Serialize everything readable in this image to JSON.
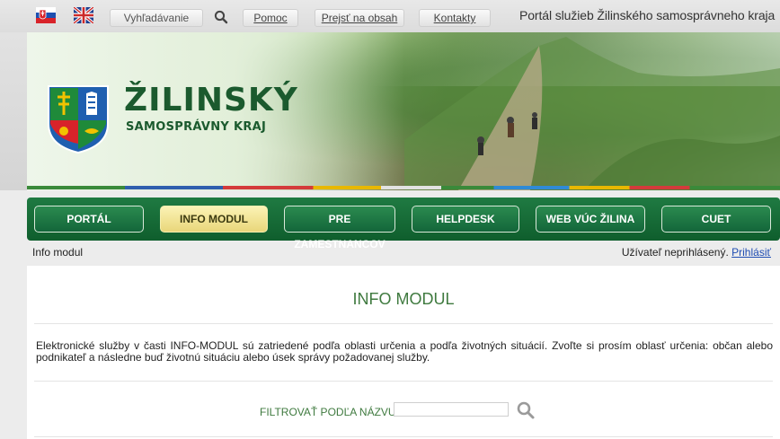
{
  "topbar": {
    "flag_sk_icon": "slovak-flag-icon",
    "flag_uk_icon": "uk-flag-icon",
    "search_label": "Vyhľadávanie",
    "search_icon": "search-icon",
    "help": "Pomoc",
    "skip": "Prejsť na obsah",
    "contacts": "Kontakty",
    "portal_title": "Portál služieb Žilinského samosprávneho kraja"
  },
  "banner": {
    "logo_title": "ŽILINSKÝ",
    "logo_subtitle": "SAMOSPRÁVNY KRAJ",
    "crest_icon": "coat-of-arms-icon"
  },
  "nav": {
    "items": [
      {
        "label": "PORTÁL",
        "active": false
      },
      {
        "label": "INFO MODUL",
        "active": true
      },
      {
        "label": "PRE ZAMESTNANCOV",
        "active": false
      },
      {
        "label": "HELPDESK",
        "active": false
      },
      {
        "label": "WEB VÚC ŽILINA",
        "active": false
      },
      {
        "label": "CUET",
        "active": false
      }
    ]
  },
  "breadcrumb": "Info modul",
  "user": {
    "status": "Užívateľ neprihlásený.",
    "login": "Prihlásiť"
  },
  "main": {
    "heading": "INFO MODUL",
    "intro": "Elektronické služby v časti INFO-MODUL sú zatriedené podľa oblasti určenia a podľa životných situácií. Zvoľte si prosím oblasť určenia: občan alebo podnikateľ a následne buď životnú situáciu alebo úsek správy požadovanej služby.",
    "filter_label": "FILTROVAŤ PODĽA NÁZVU",
    "filter_value": "",
    "filter_icon": "search-icon"
  },
  "colors": {
    "brand_green": "#1b5a2e",
    "nav_green": "#13663a",
    "active_tab": "#e9d67a",
    "heading_green": "#3f7a3f",
    "link_blue": "#1f4db3"
  }
}
